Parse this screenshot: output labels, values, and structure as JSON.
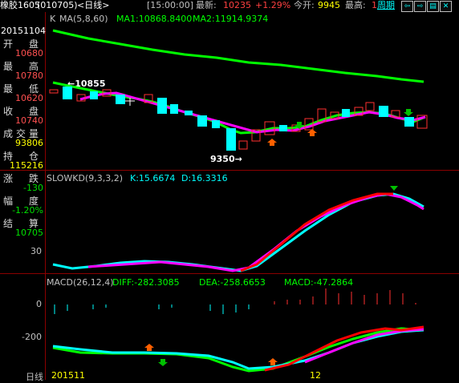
{
  "topbar": {
    "symbol": "橡胶1605",
    "code": "(010705)",
    "period": "<日线>",
    "time": "[15:00:00]",
    "latest_label": "最新:",
    "latest_value": "10235",
    "change_pct": "+1.29%",
    "open_label": "今开:",
    "open_value": "9945",
    "high_label": "最高:",
    "high_value": "1",
    "week_label": "周期"
  },
  "window_icons": [
    "back-icon",
    "forward-icon",
    "menu-icon",
    "close-icon"
  ],
  "left_panel": {
    "date": "20151104",
    "fields": [
      {
        "label": "开　盘",
        "value": "10680",
        "color": "#ff5050"
      },
      {
        "label": "最　高",
        "value": "10780",
        "color": "#ff5050"
      },
      {
        "label": "最　低",
        "value": "10620",
        "color": "#ff5050"
      },
      {
        "label": "收　盘",
        "value": "10740",
        "color": "#ff5050"
      },
      {
        "label": "成交量",
        "value": "93806",
        "color": "#ffff00"
      },
      {
        "label": "持　仓",
        "value": "115216",
        "color": "#ffff00"
      },
      {
        "label": "涨　跌",
        "value": "-130",
        "color": "#00e000"
      },
      {
        "label": "幅　度",
        "value": "-1.20%",
        "color": "#00e000"
      },
      {
        "label": "结　算",
        "value": "10705",
        "color": "#00e000"
      }
    ]
  },
  "ma_panel": {
    "k_label": "K",
    "ma_title": "MA(5,8,60)",
    "ma1": "MA1:10868.8400",
    "ma2": "MA2:11914.9374",
    "high_marker": "←10855",
    "low_marker": "9350→"
  },
  "kd_panel": {
    "title": "SLOWKD(9,3,3,2)",
    "k": "K:15.6674",
    "d": "D:16.3316",
    "axis_label": "30"
  },
  "macd_panel": {
    "title": "MACD(26,12,4)",
    "diff": "DIFF:-282.3085",
    "dea": "DEA:-258.6653",
    "macd": "MACD:-47.2864",
    "axis_labels": [
      "0",
      "-200"
    ]
  },
  "bottom": {
    "left_label": "日线",
    "date_left": "201511",
    "date_right": "12"
  },
  "colors": {
    "up": "#ff3030",
    "down": "#00ffff",
    "ma_green": "#00ff00",
    "ma_magenta": "#ff00ff",
    "grid": "#8b0000"
  }
}
